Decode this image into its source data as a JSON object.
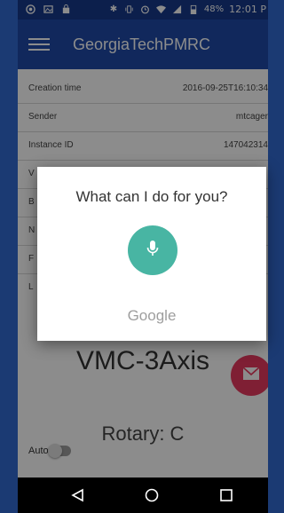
{
  "status_bar": {
    "icons": [
      "chrome-icon",
      "image-icon",
      "shopping-bag-icon",
      "bluetooth-icon",
      "vibrate-icon",
      "alarm-icon",
      "wifi-icon",
      "signal-icon",
      "battery-icon"
    ],
    "battery": "48%",
    "time": "12:01 P"
  },
  "app_bar": {
    "title": "GeorgiaTechPMRC"
  },
  "details": {
    "rows": [
      {
        "label": "Creation time",
        "value": "2016-09-25T16:10:34"
      },
      {
        "label": "Sender",
        "value": "mtcager"
      },
      {
        "label": "Instance ID",
        "value": "147042314"
      },
      {
        "label": "V",
        "value": ""
      },
      {
        "label": "B",
        "value": ""
      },
      {
        "label": "N",
        "value": ""
      },
      {
        "label": "F",
        "value": ""
      },
      {
        "label": "L",
        "value": ""
      }
    ]
  },
  "machine": {
    "name": "VMC-3Axis",
    "rotary": "Rotary: C"
  },
  "auto": {
    "label": "Auto",
    "on": false
  },
  "dialog": {
    "prompt": "What can I do for you?",
    "brand": "Google"
  },
  "colors": {
    "accent_fab": "#e83a5f",
    "mic": "#48b5a3",
    "appbar": "#1f4aa8"
  }
}
